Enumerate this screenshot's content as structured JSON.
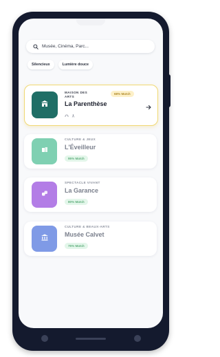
{
  "search": {
    "placeholder": "Musée, Cinéma, Parc..."
  },
  "filters": [
    "Silencieux",
    "Lumière douce"
  ],
  "cards": [
    {
      "category_line1": "MAISON DES",
      "category_line2": "ARTS",
      "title": "La Parenthèse",
      "match": "68% Match",
      "icon": "building-icon",
      "tile_color": "#1f6e66",
      "featured": true
    },
    {
      "category": "CULTURE & JEUX",
      "title": "L'Éveilleur",
      "match": "95% Match",
      "icon": "book-icon",
      "tile_color": "#7fd0b2"
    },
    {
      "category": "SPECTACLE VIVANT",
      "title": "La Garance",
      "match": "80% Match",
      "icon": "masks-icon",
      "tile_color": "#b37de6"
    },
    {
      "category": "CULTURE & BEAUX-ARTS",
      "title": "Musée Calvet",
      "match": "75% Match",
      "icon": "museum-icon",
      "tile_color": "#7f9ae6"
    }
  ],
  "colors": {
    "phone_frame": "#141a2e",
    "featured_border": "#f0d873",
    "match_badge_bg": "#e3f6ea",
    "match_badge_text": "#5fae7c",
    "featured_badge_bg": "#fdf0c8"
  }
}
